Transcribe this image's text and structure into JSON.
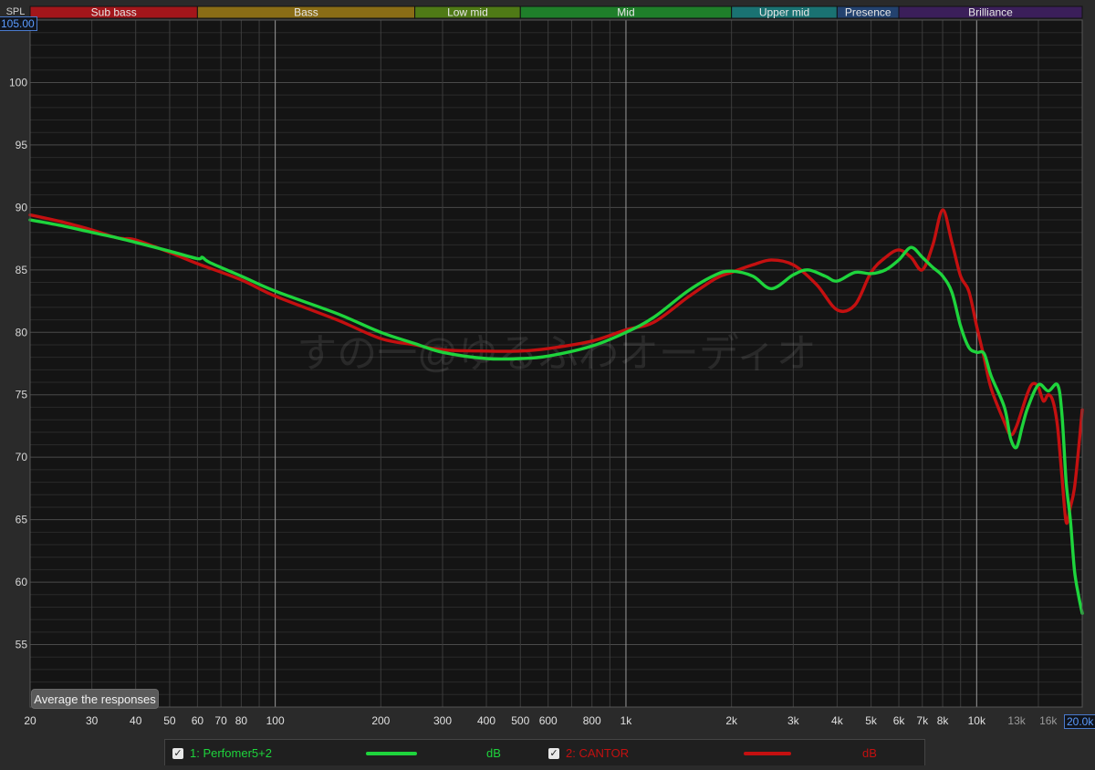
{
  "bands": [
    {
      "label": "Sub bass",
      "from": 20,
      "to": 60,
      "color": "#a3161b"
    },
    {
      "label": "Bass",
      "from": 60,
      "to": 250,
      "color": "#8a6d16"
    },
    {
      "label": "Low mid",
      "from": 250,
      "to": 500,
      "color": "#4f7a16"
    },
    {
      "label": "Mid",
      "from": 500,
      "to": 2000,
      "color": "#1f7f2a"
    },
    {
      "label": "Upper mid",
      "from": 2000,
      "to": 4000,
      "color": "#1a7272"
    },
    {
      "label": "Presence",
      "from": 4000,
      "to": 6000,
      "color": "#23426f"
    },
    {
      "label": "Brilliance",
      "from": 6000,
      "to": 20000,
      "color": "#3b1f5a"
    }
  ],
  "top_range_value": "105.00",
  "bottom_range_value": "20.0k",
  "average_button_label": "Average the responses",
  "watermark": "すの一@ゆるふわオーディオ",
  "legend": [
    {
      "checked": "✓",
      "label": "1: Perfomer5+2",
      "unit": "dB",
      "color": "#1ed43c"
    },
    {
      "checked": "✓",
      "label": "2: CANTOR",
      "unit": "dB",
      "color": "#c41010"
    }
  ],
  "chart_data": {
    "type": "line",
    "ylabel": "SPL",
    "xscale": "log",
    "xlim": [
      20,
      20000
    ],
    "ylim": [
      50,
      105
    ],
    "grid": true,
    "y_ticks": [
      55,
      60,
      65,
      70,
      75,
      80,
      85,
      90,
      95,
      100
    ],
    "x_ticks": [
      {
        "v": 20,
        "label": "20"
      },
      {
        "v": 30,
        "label": "30"
      },
      {
        "v": 40,
        "label": "40"
      },
      {
        "v": 50,
        "label": "50"
      },
      {
        "v": 60,
        "label": "60"
      },
      {
        "v": 70,
        "label": "70"
      },
      {
        "v": 80,
        "label": "80"
      },
      {
        "v": 100,
        "label": "100"
      },
      {
        "v": 200,
        "label": "200"
      },
      {
        "v": 300,
        "label": "300"
      },
      {
        "v": 400,
        "label": "400"
      },
      {
        "v": 500,
        "label": "500"
      },
      {
        "v": 600,
        "label": "600"
      },
      {
        "v": 800,
        "label": "800"
      },
      {
        "v": 1000,
        "label": "1k"
      },
      {
        "v": 2000,
        "label": "2k"
      },
      {
        "v": 3000,
        "label": "3k"
      },
      {
        "v": 4000,
        "label": "4k"
      },
      {
        "v": 5000,
        "label": "5k"
      },
      {
        "v": 6000,
        "label": "6k"
      },
      {
        "v": 7000,
        "label": "7k"
      },
      {
        "v": 8000,
        "label": "8k"
      },
      {
        "v": 10000,
        "label": "10k"
      },
      {
        "v": 13000,
        "label": "13k"
      },
      {
        "v": 16000,
        "label": "16k"
      }
    ],
    "series": [
      {
        "name": "1: Perfomer5+2",
        "color": "#1ed43c",
        "points": [
          [
            20,
            89.0
          ],
          [
            25,
            88.5
          ],
          [
            30,
            88.0
          ],
          [
            35,
            87.6
          ],
          [
            40,
            87.2
          ],
          [
            50,
            86.5
          ],
          [
            60,
            85.9
          ],
          [
            62,
            86.0
          ],
          [
            65,
            85.6
          ],
          [
            80,
            84.5
          ],
          [
            100,
            83.3
          ],
          [
            150,
            81.5
          ],
          [
            200,
            80.0
          ],
          [
            250,
            79.1
          ],
          [
            300,
            78.4
          ],
          [
            400,
            77.9
          ],
          [
            500,
            77.9
          ],
          [
            600,
            78.1
          ],
          [
            800,
            78.9
          ],
          [
            1000,
            80.0
          ],
          [
            1200,
            81.2
          ],
          [
            1500,
            83.3
          ],
          [
            1800,
            84.6
          ],
          [
            2000,
            84.9
          ],
          [
            2300,
            84.5
          ],
          [
            2600,
            83.5
          ],
          [
            3000,
            84.6
          ],
          [
            3300,
            85.0
          ],
          [
            3700,
            84.5
          ],
          [
            4000,
            84.1
          ],
          [
            4500,
            84.8
          ],
          [
            5000,
            84.7
          ],
          [
            5500,
            85.0
          ],
          [
            6000,
            85.8
          ],
          [
            6500,
            86.8
          ],
          [
            7000,
            86.0
          ],
          [
            7500,
            85.2
          ],
          [
            8000,
            84.5
          ],
          [
            8500,
            83.2
          ],
          [
            9000,
            80.5
          ],
          [
            9500,
            78.8
          ],
          [
            10000,
            78.4
          ],
          [
            10500,
            78.3
          ],
          [
            11000,
            76.5
          ],
          [
            12000,
            74.0
          ],
          [
            12500,
            71.5
          ],
          [
            13000,
            70.8
          ],
          [
            13500,
            72.5
          ],
          [
            14000,
            74.0
          ],
          [
            15000,
            75.8
          ],
          [
            16000,
            75.3
          ],
          [
            17000,
            75.8
          ],
          [
            17500,
            73.5
          ],
          [
            18000,
            68.0
          ],
          [
            18500,
            65.0
          ],
          [
            19000,
            61.0
          ],
          [
            19500,
            59.0
          ],
          [
            20000,
            57.5
          ]
        ]
      },
      {
        "name": "2: CANTOR",
        "color": "#c41010",
        "points": [
          [
            20,
            89.4
          ],
          [
            25,
            88.8
          ],
          [
            30,
            88.2
          ],
          [
            35,
            87.6
          ],
          [
            37,
            87.5
          ],
          [
            40,
            87.4
          ],
          [
            50,
            86.4
          ],
          [
            60,
            85.5
          ],
          [
            80,
            84.2
          ],
          [
            100,
            82.9
          ],
          [
            150,
            81.0
          ],
          [
            200,
            79.5
          ],
          [
            250,
            79.0
          ],
          [
            300,
            78.6
          ],
          [
            400,
            78.5
          ],
          [
            500,
            78.5
          ],
          [
            600,
            78.7
          ],
          [
            800,
            79.3
          ],
          [
            1000,
            80.2
          ],
          [
            1200,
            80.8
          ],
          [
            1500,
            82.8
          ],
          [
            1800,
            84.3
          ],
          [
            2000,
            84.8
          ],
          [
            2300,
            85.4
          ],
          [
            2600,
            85.8
          ],
          [
            3000,
            85.4
          ],
          [
            3500,
            83.8
          ],
          [
            4000,
            81.8
          ],
          [
            4500,
            82.2
          ],
          [
            5000,
            84.8
          ],
          [
            5500,
            86.0
          ],
          [
            6000,
            86.6
          ],
          [
            6500,
            86.0
          ],
          [
            7000,
            85.0
          ],
          [
            7500,
            87.0
          ],
          [
            8000,
            89.8
          ],
          [
            8500,
            87.2
          ],
          [
            9000,
            84.5
          ],
          [
            9500,
            83.3
          ],
          [
            10000,
            80.5
          ],
          [
            10500,
            78.0
          ],
          [
            11000,
            75.5
          ],
          [
            12000,
            72.8
          ],
          [
            12500,
            71.8
          ],
          [
            13000,
            72.5
          ],
          [
            14000,
            75.2
          ],
          [
            14500,
            75.9
          ],
          [
            15000,
            75.6
          ],
          [
            15500,
            74.5
          ],
          [
            16000,
            75.0
          ],
          [
            16500,
            74.5
          ],
          [
            17000,
            72.5
          ],
          [
            17500,
            68.5
          ],
          [
            18000,
            64.8
          ],
          [
            18500,
            66.0
          ],
          [
            19000,
            67.5
          ],
          [
            19500,
            70.5
          ],
          [
            20000,
            73.8
          ]
        ]
      }
    ]
  }
}
